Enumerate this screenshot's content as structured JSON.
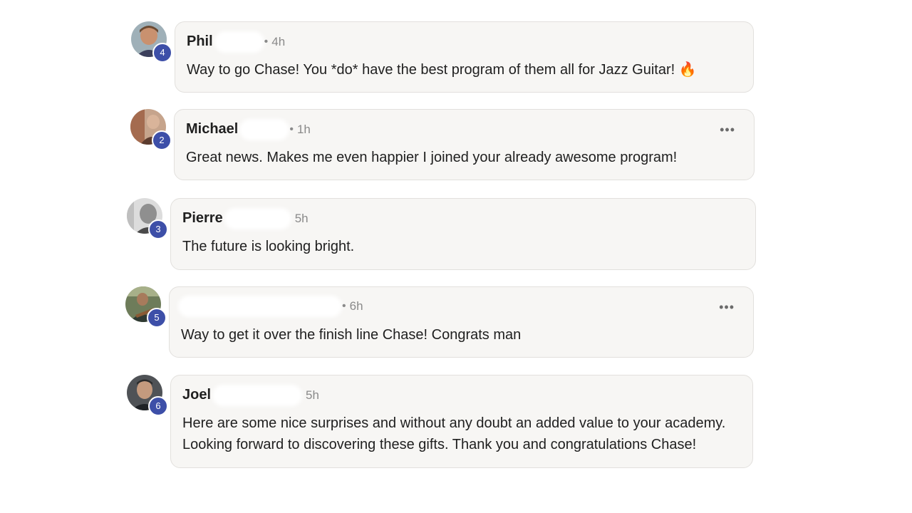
{
  "comments": [
    {
      "author": "Phil",
      "separator": "•",
      "time": "4h",
      "level": "4",
      "text": "Way to go Chase! You *do* have the best program of them all for Jazz Guitar! 🔥",
      "avatar_icon": "user-avatar-icon",
      "more_label": ""
    },
    {
      "author": "Michael",
      "separator": "•",
      "time": "1h",
      "level": "2",
      "text": "Great news. Makes me even happier I joined your already awesome program!",
      "avatar_icon": "user-avatar-icon",
      "more_label": "•••"
    },
    {
      "author": "Pierre",
      "separator": "",
      "time": "5h",
      "level": "3",
      "text": "The future is looking bright.",
      "avatar_icon": "user-avatar-icon",
      "more_label": ""
    },
    {
      "author": "",
      "separator": "•",
      "time": "6h",
      "level": "5",
      "text": "Way to get it over the finish line Chase! Congrats man",
      "avatar_icon": "user-avatar-icon",
      "more_label": "•••"
    },
    {
      "author": "Joel",
      "separator": "",
      "time": "5h",
      "level": "6",
      "text": "Here are some nice surprises and without any doubt an added value to your academy.\nLooking forward to discovering these gifts. Thank you and congratulations Chase!",
      "avatar_icon": "user-avatar-icon",
      "more_label": ""
    }
  ],
  "colors": {
    "badge": "#3d4fa8",
    "bubble_bg": "#f7f6f4",
    "bubble_border": "#e2e0dd",
    "meta_text": "#8a8a8a"
  }
}
